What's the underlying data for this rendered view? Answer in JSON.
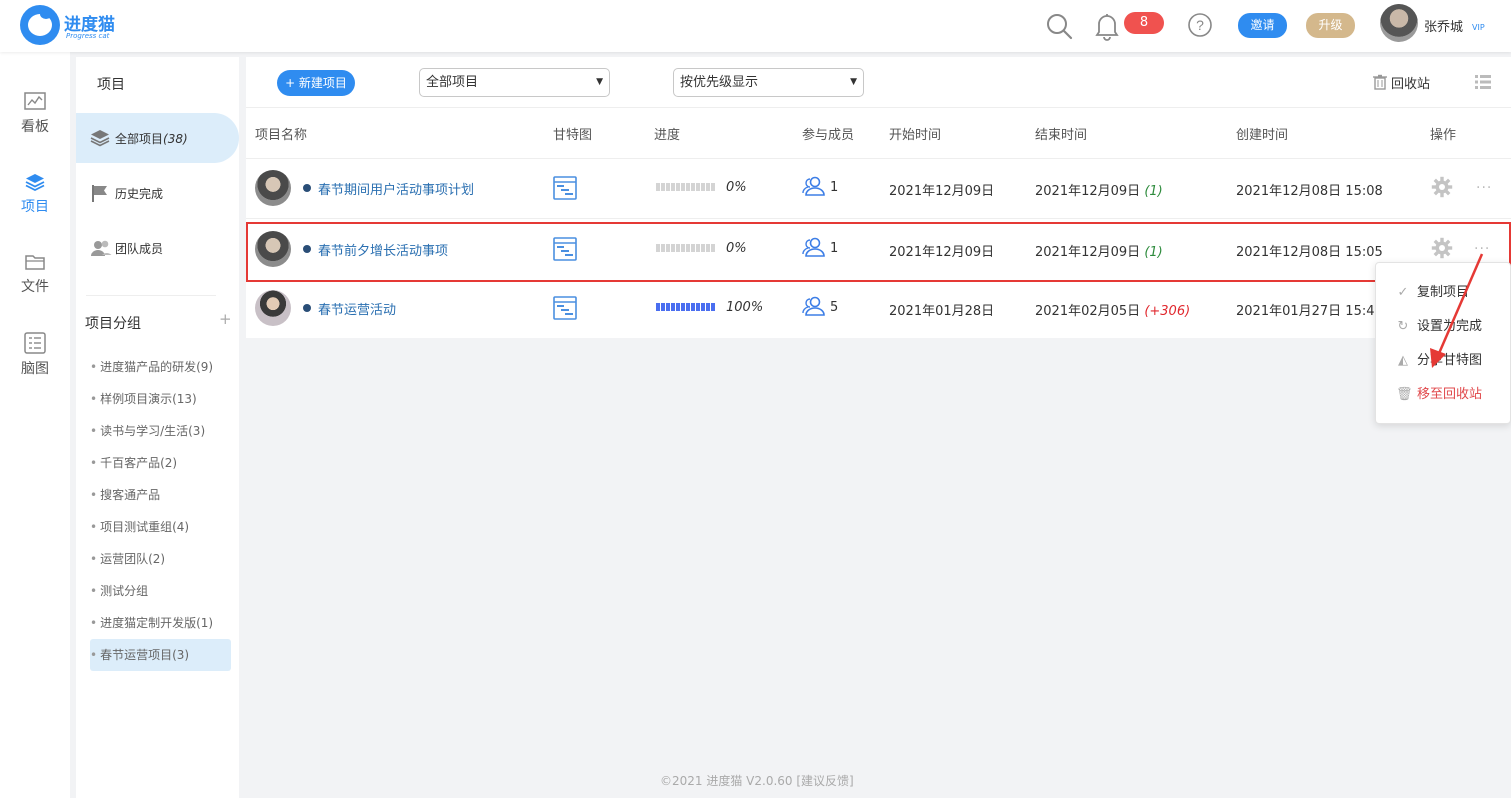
{
  "app": {
    "name": "进度猫",
    "subtitle": "Progress cat"
  },
  "topbar": {
    "notification_count": "8",
    "invite_label": "邀请",
    "upgrade_label": "升级",
    "user_name": "张乔城",
    "vip_label": "VIP"
  },
  "left_nav": [
    {
      "label": "看板",
      "icon": "chart-icon"
    },
    {
      "label": "项目",
      "icon": "layers-icon",
      "active": true
    },
    {
      "label": "文件",
      "icon": "folder-icon"
    },
    {
      "label": "脑图",
      "icon": "mindmap-icon"
    }
  ],
  "sub_nav": {
    "title": "项目",
    "items": [
      {
        "label": "全部项目",
        "count": "(38)",
        "active": true
      },
      {
        "label": "历史完成"
      },
      {
        "label": "团队成员"
      }
    ],
    "group_title": "项目分组",
    "group_add": "+",
    "groups": [
      "进度猫产品的研发(9)",
      "样例项目演示(13)",
      "读书与学习/生活(3)",
      "千百客产品(2)",
      "搜客通产品",
      "项目测试重组(4)",
      "运营团队(2)",
      "测试分组",
      "进度猫定制开发版(1)",
      "春节运营项目(3)"
    ]
  },
  "toolbar": {
    "new_project": "+ 新建项目",
    "filter_value": "全部项目",
    "sort_value": "按优先级显示",
    "recycle_label": "回收站"
  },
  "table": {
    "headers": [
      "项目名称",
      "甘特图",
      "进度",
      "参与成员",
      "开始时间",
      "结束时间",
      "创建时间",
      "操作"
    ],
    "rows": [
      {
        "name": "春节期间用户活动事项计划",
        "progress": "0%",
        "progress_value": 0,
        "members": "1",
        "start": "2021年12月09日",
        "end": "2021年12月09日",
        "end_delta": "(1)",
        "created": "2021年12月08日 15:08"
      },
      {
        "name": "春节前夕增长活动事项",
        "progress": "0%",
        "progress_value": 0,
        "members": "1",
        "start": "2021年12月09日",
        "end": "2021年12月09日",
        "end_delta": "(1)",
        "created": "2021年12月08日 15:05",
        "highlighted": true
      },
      {
        "name": "春节运营活动",
        "progress": "100%",
        "progress_value": 100,
        "members": "5",
        "start": "2021年01月28日",
        "end": "2021年02月05日",
        "end_delta": "(+306)",
        "created": "2021年01月27日 15:43"
      }
    ]
  },
  "context_menu": [
    "复制项目",
    "设置为完成",
    "分享甘特图",
    "移至回收站"
  ],
  "footer": {
    "version": "©2021 进度猫 V2.0.60",
    "feedback": "[建议反馈]"
  },
  "colors": {
    "accent": "#2f8cf0",
    "highlight_border": "#e53935",
    "danger": "#e0484b"
  }
}
